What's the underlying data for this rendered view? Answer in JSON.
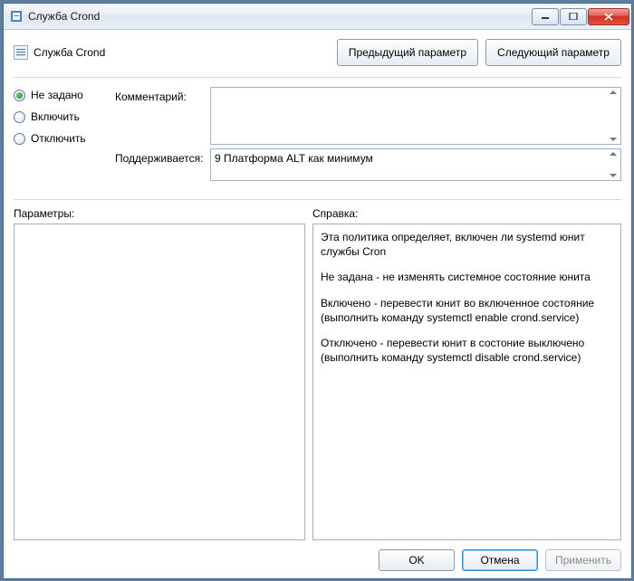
{
  "window": {
    "title": "Служба Crond"
  },
  "header": {
    "title": "Служба Crond",
    "prev_label": "Предыдущий параметр",
    "next_label": "Следующий параметр"
  },
  "state": {
    "options": [
      {
        "label": "Не задано",
        "checked": true
      },
      {
        "label": "Включить",
        "checked": false
      },
      {
        "label": "Отключить",
        "checked": false
      }
    ]
  },
  "fields": {
    "comment_label": "Комментарий:",
    "comment_value": "",
    "supported_label": "Поддерживается:",
    "supported_value": "9 Платформа ALT как минимум"
  },
  "sections": {
    "parameters_label": "Параметры:",
    "help_label": "Справка:"
  },
  "help": {
    "p1": "Эта политика определяет, включен ли systemd юнит службы Cron",
    "p2": "Не задана - не изменять системное состояние юнита",
    "p3": "Включено - перевести юнит во включенное состояние (выполнить команду systemctl enable crond.service)",
    "p4": "Отключено - перевести юнит в состоние выключено (выполнить команду systemctl disable crond.service)"
  },
  "buttons": {
    "ok": "OK",
    "cancel": "Отмена",
    "apply": "Применить"
  }
}
